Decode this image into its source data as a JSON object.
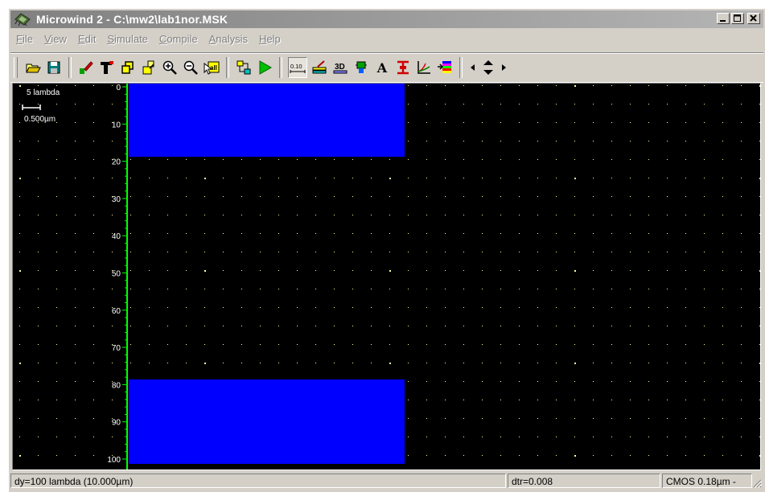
{
  "window": {
    "title": "Microwind 2 - C:\\mw2\\lab1nor.MSK",
    "app_icon": "microwind-logo-icon",
    "controls": [
      "minimize-icon",
      "maximize-icon",
      "close-icon"
    ]
  },
  "menu": {
    "items": [
      {
        "label": "File",
        "key": "F"
      },
      {
        "label": "View",
        "key": "V"
      },
      {
        "label": "Edit",
        "key": "E"
      },
      {
        "label": "Simulate",
        "key": "S"
      },
      {
        "label": "Compile",
        "key": "C"
      },
      {
        "label": "Analysis",
        "key": "A"
      },
      {
        "label": "Help",
        "key": "H"
      }
    ]
  },
  "toolbar": {
    "zoom_scale_label": "0.10",
    "view3d_label": "3D",
    "text_tool_label": "A",
    "icons": [
      "open-folder-icon",
      "save-icon",
      "draw-box-icon",
      "protect-icon",
      "duplicate-icon",
      "move-icon",
      "zoom-in-icon",
      "zoom-out-icon",
      "view-all-icon",
      "compile-icon",
      "run-simulation-icon",
      "scale-icon",
      "measure-icon",
      "3d-view-icon",
      "connect-icon",
      "text-icon",
      "cross-section-icon",
      "analog-plot-icon",
      "palette-icon",
      "navigate-arrows-icon"
    ]
  },
  "canvas": {
    "background": "#000000",
    "scale_label_lambda": "5 lambda",
    "scale_label_um": "0.500µm",
    "ruler_ticks": [
      "0",
      "10",
      "20",
      "30",
      "40",
      "50",
      "60",
      "70",
      "80",
      "90",
      "100"
    ],
    "layer_color": "#0000ff",
    "ruler_color": "#00ff00",
    "grid_color": "#ffff99"
  },
  "status": {
    "dimension": "dy=100 lambda (10.000µm)",
    "dtr": "dtr=0.008",
    "technology": "CMOS 0.18µm -"
  }
}
